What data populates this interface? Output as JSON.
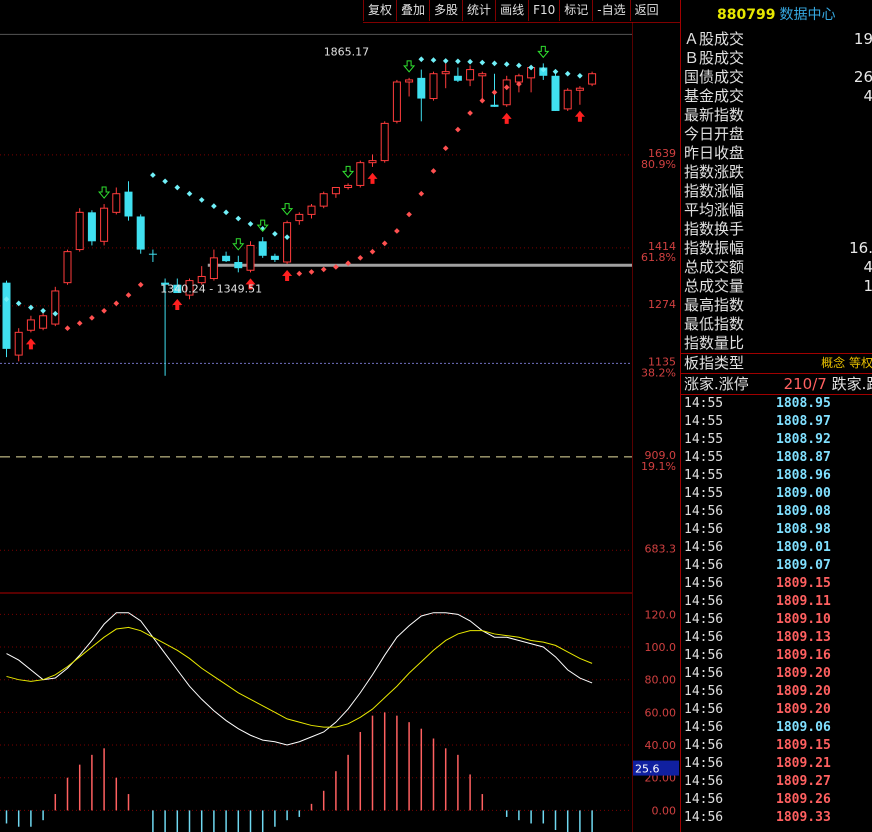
{
  "toolbar": [
    "复权",
    "叠加",
    "多股",
    "统计",
    "画线",
    "F10",
    "标记",
    "-自选",
    "返回"
  ],
  "panel": {
    "code": "880799",
    "title": "数据中心",
    "stats": [
      {
        "label": "Ａ股成交",
        "value": "19"
      },
      {
        "label": "Ｂ股成交",
        "value": ""
      },
      {
        "label": "国债成交",
        "value": "26"
      },
      {
        "label": "基金成交",
        "value": "4"
      },
      {
        "label": "最新指数",
        "value": ""
      },
      {
        "label": "今日开盘",
        "value": ""
      },
      {
        "label": "昨日收盘",
        "value": ""
      },
      {
        "label": "指数涨跌",
        "value": ""
      },
      {
        "label": "指数涨幅",
        "value": ""
      },
      {
        "label": "平均涨幅",
        "value": ""
      },
      {
        "label": "指数换手",
        "value": ""
      },
      {
        "label": "指数振幅",
        "value": "16."
      },
      {
        "label": "总成交额",
        "value": "4"
      },
      {
        "label": "总成交量",
        "value": "1"
      },
      {
        "label": "最高指数",
        "value": ""
      },
      {
        "label": "最低指数",
        "value": ""
      },
      {
        "label": "指数量比",
        "value": ""
      }
    ],
    "type_row": {
      "label": "板指类型",
      "value": "概念 等权"
    },
    "limit_row": {
      "label": "涨家.涨停",
      "value": "210/7",
      "label2": "跌家.跌停"
    },
    "ticks": [
      {
        "t": "14:55",
        "p": "1808.95",
        "c": "#80e0ff"
      },
      {
        "t": "14:55",
        "p": "1808.97",
        "c": "#80e0ff"
      },
      {
        "t": "14:55",
        "p": "1808.92",
        "c": "#80e0ff"
      },
      {
        "t": "14:55",
        "p": "1808.87",
        "c": "#80e0ff"
      },
      {
        "t": "14:55",
        "p": "1808.96",
        "c": "#80e0ff"
      },
      {
        "t": "14:55",
        "p": "1809.00",
        "c": "#80e0ff"
      },
      {
        "t": "14:56",
        "p": "1809.08",
        "c": "#80e0ff"
      },
      {
        "t": "14:56",
        "p": "1808.98",
        "c": "#80e0ff"
      },
      {
        "t": "14:56",
        "p": "1809.01",
        "c": "#80e0ff"
      },
      {
        "t": "14:56",
        "p": "1809.07",
        "c": "#80e0ff"
      },
      {
        "t": "14:56",
        "p": "1809.15",
        "c": "#ff6060"
      },
      {
        "t": "14:56",
        "p": "1809.11",
        "c": "#ff6060"
      },
      {
        "t": "14:56",
        "p": "1809.10",
        "c": "#ff6060"
      },
      {
        "t": "14:56",
        "p": "1809.13",
        "c": "#ff6060"
      },
      {
        "t": "14:56",
        "p": "1809.16",
        "c": "#ff6060"
      },
      {
        "t": "14:56",
        "p": "1809.20",
        "c": "#ff6060"
      },
      {
        "t": "14:56",
        "p": "1809.20",
        "c": "#ff6060"
      },
      {
        "t": "14:56",
        "p": "1809.20",
        "c": "#ff6060"
      },
      {
        "t": "14:56",
        "p": "1809.06",
        "c": "#80e0ff"
      },
      {
        "t": "14:56",
        "p": "1809.15",
        "c": "#ff6060"
      },
      {
        "t": "14:56",
        "p": "1809.21",
        "c": "#ff6060"
      },
      {
        "t": "14:56",
        "p": "1809.27",
        "c": "#ff6060"
      },
      {
        "t": "14:56",
        "p": "1809.26",
        "c": "#ff6060"
      },
      {
        "t": "14:56",
        "p": "1809.33",
        "c": "#ff6060"
      }
    ]
  },
  "chart_data": {
    "type": "candlestick",
    "colors": {
      "up": "#ff3c3c",
      "down": "#40e0f0",
      "sar_up": "#ff5050",
      "sar_down": "#70f0f8",
      "grid": "#7a0000",
      "macd_line": "#ffffff",
      "signal_line": "#e8e800"
    },
    "price_axis": {
      "ylim": [
        580,
        1960
      ],
      "levels": [
        {
          "value": 1639,
          "label": "1639",
          "pct": "80.9%"
        },
        {
          "value": 1414,
          "label": "1414",
          "pct": "61.8%"
        },
        {
          "value": 1274,
          "label": "1274",
          "pct": ""
        },
        {
          "value": 1135,
          "label": "1135",
          "pct": "38.2%"
        },
        {
          "value": 909,
          "label": "909.0",
          "pct": "19.1%"
        },
        {
          "value": 683.3,
          "label": "683.3",
          "pct": ""
        }
      ],
      "dashed_level": 1135,
      "yellow_dashed_level": 909,
      "support_level": 1372
    },
    "annotations": [
      {
        "text": "1340.24 - 1349.51",
        "x_index": 12.6,
        "y": 1340
      },
      {
        "text": "1865.17",
        "x_index": 26,
        "y": 1865
      }
    ],
    "candles": [
      {
        "o": 1330,
        "h": 1335,
        "l": 1150,
        "c": 1170
      },
      {
        "o": 1155,
        "h": 1220,
        "l": 1140,
        "c": 1210
      },
      {
        "o": 1215,
        "h": 1250,
        "l": 1210,
        "c": 1240
      },
      {
        "o": 1220,
        "h": 1260,
        "l": 1215,
        "c": 1250
      },
      {
        "o": 1230,
        "h": 1320,
        "l": 1225,
        "c": 1310
      },
      {
        "o": 1330,
        "h": 1410,
        "l": 1325,
        "c": 1405
      },
      {
        "o": 1410,
        "h": 1510,
        "l": 1405,
        "c": 1500
      },
      {
        "o": 1500,
        "h": 1505,
        "l": 1420,
        "c": 1430
      },
      {
        "o": 1430,
        "h": 1520,
        "l": 1420,
        "c": 1510
      },
      {
        "o": 1500,
        "h": 1560,
        "l": 1495,
        "c": 1545
      },
      {
        "o": 1550,
        "h": 1575,
        "l": 1480,
        "c": 1490
      },
      {
        "o": 1490,
        "h": 1495,
        "l": 1400,
        "c": 1410
      },
      {
        "o": 1400,
        "h": 1410,
        "l": 1380,
        "c": 1398
      },
      {
        "o": 1330,
        "h": 1340,
        "l": 1105,
        "c": 1325
      },
      {
        "o": 1325,
        "h": 1340,
        "l": 1305,
        "c": 1305
      },
      {
        "o": 1300,
        "h": 1340,
        "l": 1290,
        "c": 1335
      },
      {
        "o": 1330,
        "h": 1370,
        "l": 1325,
        "c": 1345
      },
      {
        "o": 1340,
        "h": 1410,
        "l": 1335,
        "c": 1390
      },
      {
        "o": 1395,
        "h": 1405,
        "l": 1380,
        "c": 1382
      },
      {
        "o": 1380,
        "h": 1395,
        "l": 1355,
        "c": 1365
      },
      {
        "o": 1360,
        "h": 1430,
        "l": 1355,
        "c": 1420
      },
      {
        "o": 1430,
        "h": 1440,
        "l": 1390,
        "c": 1395
      },
      {
        "o": 1395,
        "h": 1400,
        "l": 1380,
        "c": 1385
      },
      {
        "o": 1380,
        "h": 1480,
        "l": 1375,
        "c": 1475
      },
      {
        "o": 1480,
        "h": 1500,
        "l": 1470,
        "c": 1495
      },
      {
        "o": 1495,
        "h": 1520,
        "l": 1485,
        "c": 1515
      },
      {
        "o": 1515,
        "h": 1550,
        "l": 1510,
        "c": 1545
      },
      {
        "o": 1545,
        "h": 1560,
        "l": 1535,
        "c": 1560
      },
      {
        "o": 1560,
        "h": 1570,
        "l": 1555,
        "c": 1565
      },
      {
        "o": 1565,
        "h": 1625,
        "l": 1560,
        "c": 1620
      },
      {
        "o": 1620,
        "h": 1640,
        "l": 1610,
        "c": 1625
      },
      {
        "o": 1625,
        "h": 1720,
        "l": 1620,
        "c": 1715
      },
      {
        "o": 1720,
        "h": 1820,
        "l": 1715,
        "c": 1815
      },
      {
        "o": 1815,
        "h": 1825,
        "l": 1780,
        "c": 1820
      },
      {
        "o": 1825,
        "h": 1845,
        "l": 1720,
        "c": 1775
      },
      {
        "o": 1775,
        "h": 1840,
        "l": 1770,
        "c": 1835
      },
      {
        "o": 1835,
        "h": 1860,
        "l": 1800,
        "c": 1840
      },
      {
        "o": 1830,
        "h": 1850,
        "l": 1815,
        "c": 1818
      },
      {
        "o": 1820,
        "h": 1855,
        "l": 1805,
        "c": 1845
      },
      {
        "o": 1830,
        "h": 1840,
        "l": 1770,
        "c": 1835
      },
      {
        "o": 1760,
        "h": 1835,
        "l": 1755,
        "c": 1755
      },
      {
        "o": 1760,
        "h": 1830,
        "l": 1755,
        "c": 1820
      },
      {
        "o": 1815,
        "h": 1835,
        "l": 1790,
        "c": 1830
      },
      {
        "o": 1825,
        "h": 1850,
        "l": 1790,
        "c": 1850
      },
      {
        "o": 1850,
        "h": 1860,
        "l": 1820,
        "c": 1830
      },
      {
        "o": 1830,
        "h": 1845,
        "l": 1745,
        "c": 1745
      },
      {
        "o": 1750,
        "h": 1800,
        "l": 1745,
        "c": 1795
      },
      {
        "o": 1795,
        "h": 1805,
        "l": 1760,
        "c": 1800
      },
      {
        "o": 1810,
        "h": 1840,
        "l": 1805,
        "c": 1835
      }
    ],
    "sar_down": [
      {
        "i": 0,
        "v": 1290
      },
      {
        "i": 1,
        "v": 1280
      },
      {
        "i": 2,
        "v": 1270
      },
      {
        "i": 3,
        "v": 1262
      },
      {
        "i": 4,
        "v": 1255
      },
      {
        "i": 12,
        "v": 1590
      },
      {
        "i": 13,
        "v": 1575
      },
      {
        "i": 14,
        "v": 1560
      },
      {
        "i": 15,
        "v": 1545
      },
      {
        "i": 16,
        "v": 1530
      },
      {
        "i": 17,
        "v": 1515
      },
      {
        "i": 18,
        "v": 1500
      },
      {
        "i": 19,
        "v": 1485
      },
      {
        "i": 20,
        "v": 1472
      },
      {
        "i": 21,
        "v": 1460
      },
      {
        "i": 22,
        "v": 1448
      },
      {
        "i": 23,
        "v": 1440
      },
      {
        "i": 34,
        "v": 1870
      },
      {
        "i": 35,
        "v": 1868
      },
      {
        "i": 36,
        "v": 1866
      },
      {
        "i": 37,
        "v": 1865
      },
      {
        "i": 38,
        "v": 1864
      },
      {
        "i": 39,
        "v": 1862
      },
      {
        "i": 40,
        "v": 1860
      },
      {
        "i": 41,
        "v": 1858
      },
      {
        "i": 42,
        "v": 1855
      },
      {
        "i": 43,
        "v": 1850
      },
      {
        "i": 44,
        "v": 1845
      },
      {
        "i": 45,
        "v": 1840
      },
      {
        "i": 46,
        "v": 1835
      },
      {
        "i": 47,
        "v": 1830
      }
    ],
    "sar_up": [
      {
        "i": 5,
        "v": 1220
      },
      {
        "i": 6,
        "v": 1232
      },
      {
        "i": 7,
        "v": 1245
      },
      {
        "i": 8,
        "v": 1262
      },
      {
        "i": 9,
        "v": 1280
      },
      {
        "i": 10,
        "v": 1300
      },
      {
        "i": 11,
        "v": 1325
      },
      {
        "i": 24,
        "v": 1352
      },
      {
        "i": 25,
        "v": 1356
      },
      {
        "i": 26,
        "v": 1362
      },
      {
        "i": 27,
        "v": 1368
      },
      {
        "i": 28,
        "v": 1377
      },
      {
        "i": 29,
        "v": 1390
      },
      {
        "i": 30,
        "v": 1405
      },
      {
        "i": 31,
        "v": 1425
      },
      {
        "i": 32,
        "v": 1455
      },
      {
        "i": 33,
        "v": 1495
      },
      {
        "i": 34,
        "v": 1545
      },
      {
        "i": 35,
        "v": 1600
      },
      {
        "i": 36,
        "v": 1655
      },
      {
        "i": 37,
        "v": 1700
      },
      {
        "i": 38,
        "v": 1740
      },
      {
        "i": 39,
        "v": 1770
      },
      {
        "i": 40,
        "v": 1790
      },
      {
        "i": 41,
        "v": 1802
      },
      {
        "i": 42,
        "v": 1810
      }
    ],
    "buy_signals": [
      2,
      14,
      20,
      23,
      30,
      41,
      47
    ],
    "sell_signals": [
      8,
      19,
      21,
      23,
      28,
      33,
      44
    ],
    "indicator_axis": {
      "ylim": [
        -12,
        130
      ],
      "ticks": [
        {
          "value": 120,
          "label": "120.0"
        },
        {
          "value": 100,
          "label": "100.0"
        },
        {
          "value": 80,
          "label": "80.00"
        },
        {
          "value": 60,
          "label": "60.00"
        },
        {
          "value": 40,
          "label": "40.00"
        },
        {
          "value": 20,
          "label": "20.00"
        },
        {
          "value": 0,
          "label": "0.00"
        }
      ],
      "highlight_label": "25.6"
    },
    "macd_line": [
      96,
      92,
      86,
      80,
      81,
      87,
      95,
      104,
      114,
      121,
      121,
      116,
      106,
      96,
      86,
      76,
      68,
      61,
      55,
      50,
      46,
      43,
      42,
      40,
      42,
      45,
      48,
      54,
      62,
      72,
      83,
      95,
      106,
      113,
      119,
      121,
      121,
      120,
      116,
      110,
      106,
      106,
      104,
      102,
      100,
      94,
      86,
      81,
      78
    ],
    "signal_line": [
      82,
      80,
      79,
      80,
      83,
      88,
      94,
      100,
      106,
      111,
      112,
      110,
      106,
      102,
      98,
      93,
      87,
      82,
      77,
      72,
      68,
      64,
      60,
      56,
      54,
      52,
      51,
      51,
      53,
      57,
      62,
      69,
      76,
      84,
      91,
      98,
      104,
      108,
      110,
      110,
      108,
      107,
      106,
      104,
      103,
      101,
      97,
      93,
      90
    ],
    "histogram": [
      -8,
      -10,
      -10,
      -6,
      10,
      20,
      28,
      34,
      38,
      20,
      10,
      0,
      -14,
      -20,
      -22,
      -26,
      -30,
      -32,
      -34,
      -28,
      -20,
      -14,
      -10,
      -6,
      -4,
      4,
      12,
      24,
      34,
      48,
      58,
      60,
      58,
      54,
      50,
      44,
      38,
      34,
      22,
      10,
      0,
      -4,
      -6,
      -8,
      -8,
      -12,
      -18,
      -22,
      -20
    ]
  }
}
